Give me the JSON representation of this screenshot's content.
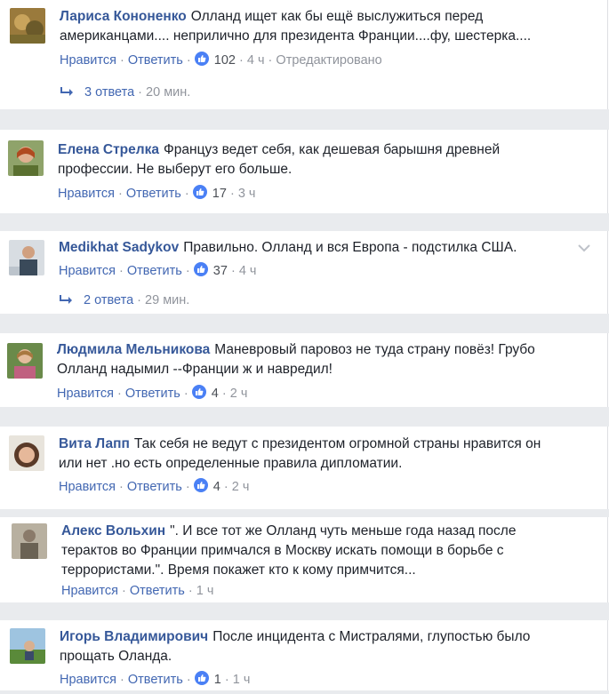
{
  "ui": {
    "like": "Нравится",
    "reply": "Ответить",
    "sep": " · "
  },
  "comments": [
    {
      "author": "Лариса Кононенко",
      "text": "Олланд ищет как бы ещё выслужиться перед американцами.... неприлично для президента Франции....фу, шестерка....",
      "likes": "102",
      "time": "4 ч",
      "edited": "Отредактировано",
      "replies": "3 ответа",
      "replies_time": "20 мин."
    },
    {
      "author": "Елена Стрелка",
      "text": "Француз ведет себя, как дешевая барышня древней профессии. Не выберут его больше.",
      "likes": "17",
      "time": "3 ч"
    },
    {
      "author": "Medikhat Sadykov",
      "text": "Правильно. Олланд и вся Европа - подстилка США.",
      "likes": "37",
      "time": "4 ч",
      "replies": "2 ответа",
      "replies_time": "29 мин."
    },
    {
      "author": "Людмила Мельникова",
      "text": "Маневровый паровоз не туда страну повёз! Грубо Олланд надымил --Франции ж и навредил!",
      "likes": "4",
      "time": "2 ч"
    },
    {
      "author": "Вита Лапп",
      "text": "Так себя не ведут с президентом огромной страны нравится он или нет .но есть определенные правила дипломатии.",
      "likes": "4",
      "time": "2 ч"
    },
    {
      "author": "Алекс Вольхин",
      "text": "\". И все тот же Олланд чуть меньше года назад после терактов во Франции примчался в Москву искать помощи в борьбе с террористами.\". Время покажет кто к кому примчится...",
      "time": "1 ч"
    },
    {
      "author": "Игорь Владимирович",
      "text": "После инцидента с Мистралями, глупостью было прощать Оланда.",
      "likes": "1",
      "time": "1 ч"
    }
  ]
}
